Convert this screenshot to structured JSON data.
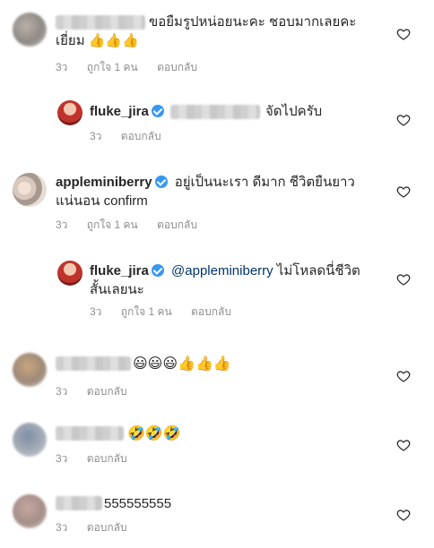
{
  "comments": [
    {
      "text_line1": "ขอยืมรูปหน่อยนะคะ ชอบมากเลยคะ",
      "text_line2": "เยี่ยม 👍👍👍",
      "time": "3ว",
      "likes": "ถูกใจ 1 คน",
      "reply": "ตอบกลับ"
    },
    {
      "username": "fluke_jira",
      "text": "จัดไปครับ",
      "time": "3ว",
      "reply": "ตอบกลับ"
    },
    {
      "username": "appleminiberry",
      "text_line1": "อยู่เป็นนะเรา ดีมาก ชีวิตยืนยาว",
      "text_line2": "แน่นอน confirm",
      "time": "3ว",
      "likes": "ถูกใจ 1 คน",
      "reply": "ตอบกลับ"
    },
    {
      "username": "fluke_jira",
      "mention": "@appleminiberry",
      "text_line1": "ไม่โหลดนี่ชีวิต",
      "text_line2": "สั้นเลยนะ",
      "time": "3ว",
      "likes": "ถูกใจ 1 คน",
      "reply": "ตอบกลับ"
    },
    {
      "text": "😃😃😃👍👍👍",
      "time": "3ว",
      "reply": "ตอบกลับ"
    },
    {
      "text": "🤣🤣🤣",
      "time": "3ว",
      "reply": "ตอบกลับ"
    },
    {
      "text": "555555555",
      "time": "3ว",
      "reply": "ตอบกลับ"
    }
  ]
}
